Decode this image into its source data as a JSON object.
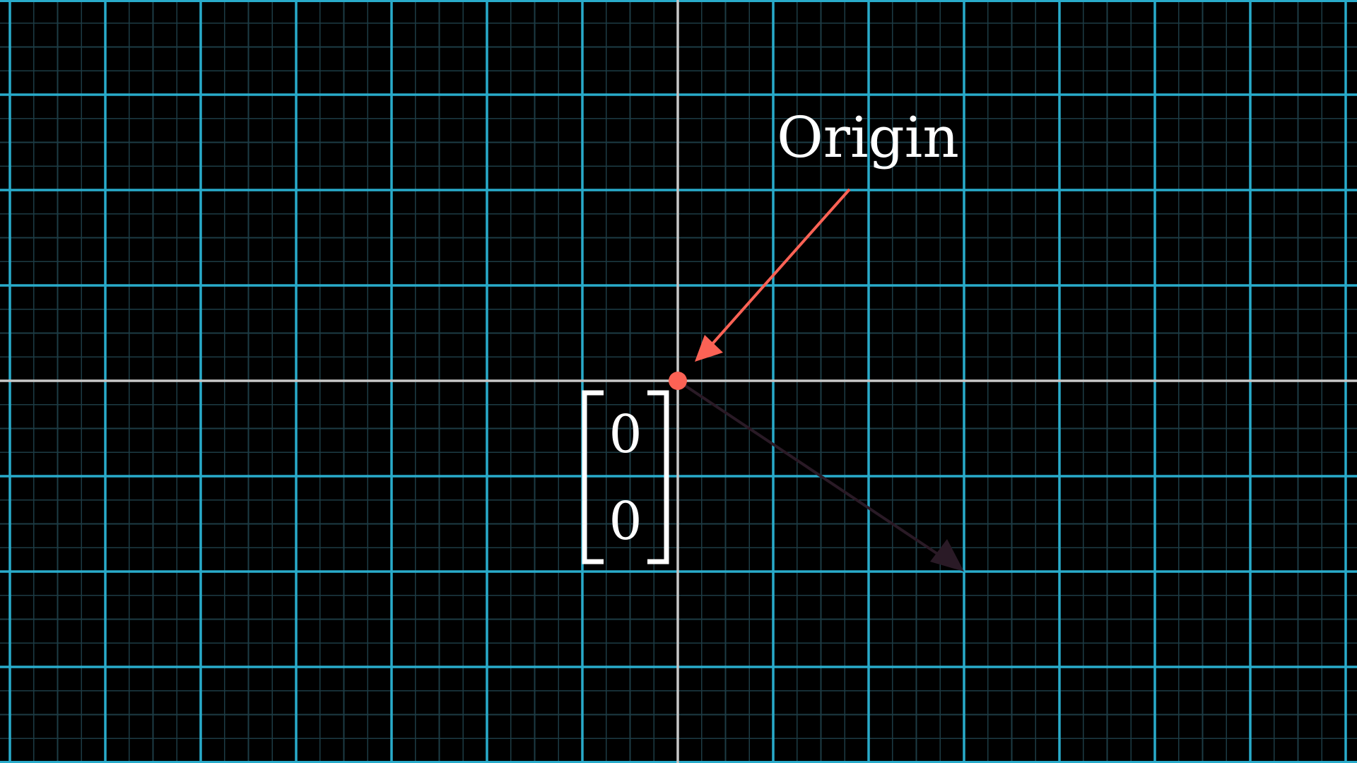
{
  "scene": {
    "annotation_label": "Origin",
    "vector_entries": [
      "0",
      "0"
    ],
    "origin": [
      0,
      0
    ],
    "faded_vector_tip": [
      3,
      -2
    ],
    "x_range": [
      -7,
      7
    ],
    "y_range": [
      -4,
      4
    ]
  },
  "colors": {
    "background": "#000000",
    "major_grid": "#29abca",
    "minor_grid": "#1d3c45",
    "axes": "#c8c8c8",
    "annotation": "#fc6255",
    "faded_vector": "#2a1a26",
    "text": "#ffffff"
  }
}
